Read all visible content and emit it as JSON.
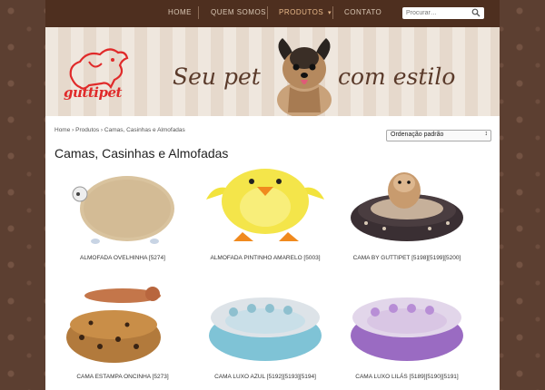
{
  "nav": {
    "items": [
      "HOME",
      "QUEM SOMOS",
      "PRODUTOS",
      "CONTATO"
    ],
    "active_index": 2,
    "dropdown_arrow": "▾"
  },
  "search": {
    "placeholder": "Procurar…"
  },
  "banner": {
    "logo_text": "guttipet",
    "slogan_left": "Seu pet",
    "slogan_right": "com estilo"
  },
  "breadcrumb": "Home › Produtos › Camas, Casinhas e Almofadas",
  "sort": {
    "selected": "Ordenação padrão"
  },
  "page_title": "Camas, Casinhas e Almofadas",
  "products": [
    {
      "name": "ALMOFADA OVELHINHA [5274]"
    },
    {
      "name": "ALMOFADA PINTINHO AMARELO [5003]"
    },
    {
      "name": "CAMA BY GUTTIPET [5198][5199][5200]"
    },
    {
      "name": "CAMA ESTAMPA ONCINHA [5273]"
    },
    {
      "name": "CAMA LUXO AZUL [5192][5193][5194]"
    },
    {
      "name": "CAMA LUXO LILÁS [5189][5190][5191]"
    }
  ],
  "colors": {
    "nav_bg": "#4e2f1f",
    "active_nav": "#e8b98a",
    "logo_red": "#e02a2a",
    "slogan_brown": "#5a3a2a"
  }
}
